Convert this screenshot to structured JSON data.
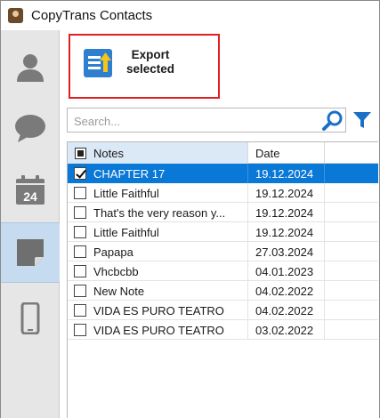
{
  "window": {
    "title": "CopyTrans Contacts"
  },
  "sidebar": {
    "items": [
      {
        "name": "contacts",
        "icon": "person-icon",
        "active": false
      },
      {
        "name": "messages",
        "icon": "chat-bubble-icon",
        "active": false
      },
      {
        "name": "calendars",
        "icon": "calendar-icon",
        "calendar_day": "24",
        "active": false
      },
      {
        "name": "notes",
        "icon": "note-icon",
        "active": true
      },
      {
        "name": "device",
        "icon": "phone-icon",
        "active": false
      }
    ]
  },
  "toolbar": {
    "export_label_line1": "Export",
    "export_label_line2": "selected"
  },
  "search": {
    "placeholder": "Search..."
  },
  "table": {
    "columns": [
      "Notes",
      "Date"
    ],
    "rows": [
      {
        "note": "CHAPTER 17",
        "date": "19.12.2024",
        "checked": true,
        "selected": true
      },
      {
        "note": "Little Faithful",
        "date": "19.12.2024",
        "checked": false,
        "selected": false
      },
      {
        "note": "That's the very reason y...",
        "date": "19.12.2024",
        "checked": false,
        "selected": false
      },
      {
        "note": "Little Faithful",
        "date": "19.12.2024",
        "checked": false,
        "selected": false
      },
      {
        "note": "Papapa",
        "date": "27.03.2024",
        "checked": false,
        "selected": false
      },
      {
        "note": "Vhcbcbb",
        "date": "04.01.2023",
        "checked": false,
        "selected": false
      },
      {
        "note": "New Note",
        "date": "04.02.2022",
        "checked": false,
        "selected": false
      },
      {
        "note": "VIDA ES PURO TEATRO",
        "date": "04.02.2022",
        "checked": false,
        "selected": false
      },
      {
        "note": "VIDA ES PURO TEATRO",
        "date": "03.02.2022",
        "checked": false,
        "selected": false
      }
    ]
  },
  "colors": {
    "accent": "#0a78d6",
    "highlight_border": "#e02020",
    "sidebar_bg": "#e6e6e6",
    "sidebar_active": "#c6dbf0",
    "icon_gray": "#7a7a7a"
  }
}
